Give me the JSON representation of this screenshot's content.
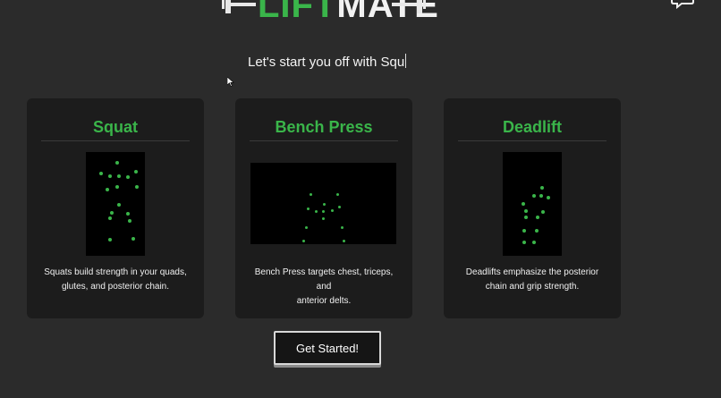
{
  "header": {
    "logo_part1": "LIFT",
    "logo_part2": "MATE",
    "icons": [
      "dumbbell-icon",
      "dumbbell-icon",
      "chat-icon"
    ]
  },
  "tagline": "Let's start you off with Squ",
  "cards": [
    {
      "title": "Squat",
      "description_line1": "Squats build strength in your quads,",
      "description_line2": "glutes, and posterior chain."
    },
    {
      "title": "Bench Press",
      "description_line1": "Bench Press targets chest, triceps, and",
      "description_line2": "anterior delts."
    },
    {
      "title": "Deadlift",
      "description_line1": "Deadlifts emphasize the posterior",
      "description_line2": "chain and grip strength."
    }
  ],
  "cta": {
    "label": "Get Started!"
  },
  "colors": {
    "accent": "#3ab54a",
    "background": "#2b2b2b",
    "card": "#1c1c1c"
  }
}
